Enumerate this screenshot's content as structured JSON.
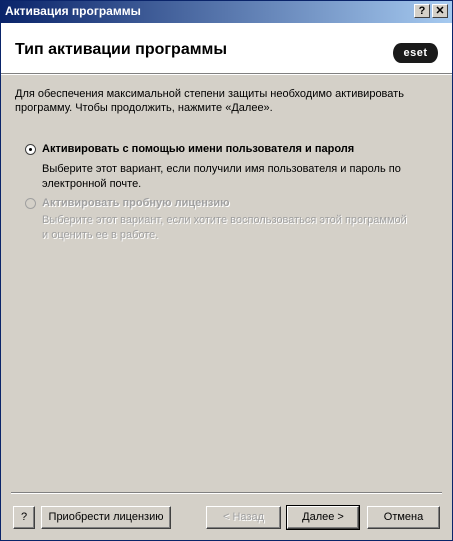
{
  "window": {
    "title": "Активация программы",
    "help_button": "?",
    "close_button": "✕"
  },
  "header": {
    "title": "Тип активации программы",
    "logo": "eset"
  },
  "description": "Для обеспечения максимальной степени защиты необходимо активировать программу. Чтобы продолжить, нажмите «Далее».",
  "options": [
    {
      "label": "Активировать с помощью имени пользователя и пароля",
      "description": "Выберите этот вариант, если получили имя пользователя и пароль по электронной почте.",
      "selected": true,
      "enabled": true
    },
    {
      "label": "Активировать пробную лицензию",
      "description": "Выберите этот вариант, если хотите воспользоваться этой программой и оценить ее в работе.",
      "selected": false,
      "enabled": false
    }
  ],
  "buttons": {
    "help": "?",
    "buy_license": "Приобрести лицензию",
    "back": "< Назад",
    "next": "Далее >",
    "cancel": "Отмена"
  }
}
